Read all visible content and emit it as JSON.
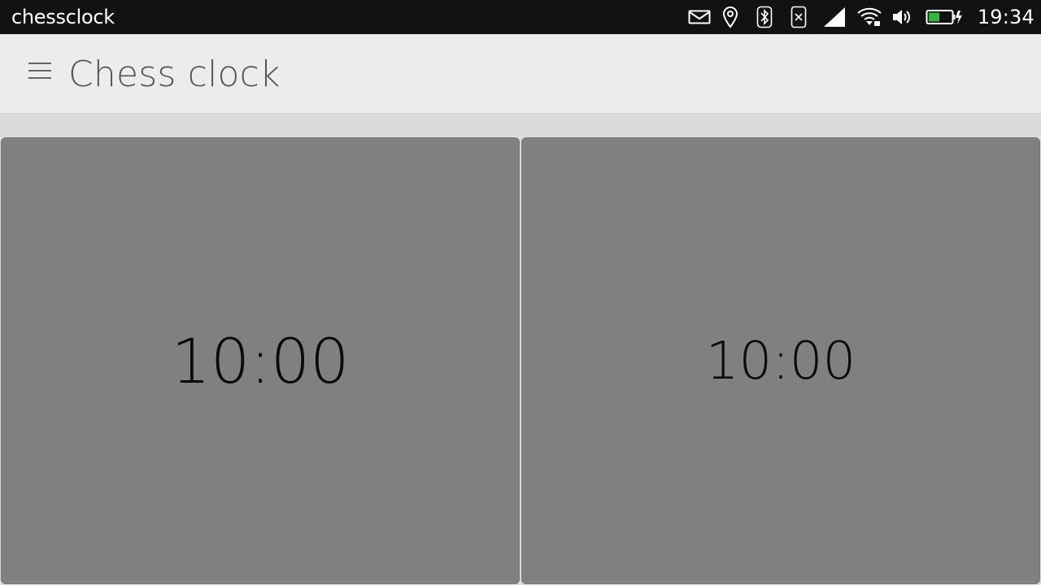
{
  "statusbar": {
    "app_name": "chessclock",
    "time": "19:34",
    "icons": [
      "mail-icon",
      "location-icon",
      "bluetooth-icon",
      "no-sim-icon",
      "signal-icon",
      "wifi-icon",
      "volume-icon",
      "battery-charging-icon"
    ],
    "battery_color": "#3cb043"
  },
  "header": {
    "title": "Chess clock",
    "menu_icon": "hamburger-menu-icon"
  },
  "clocks": {
    "left": {
      "time": "10:00"
    },
    "right": {
      "time": "10:00"
    }
  },
  "colors": {
    "panel": "#808080",
    "statusbar": "#121212",
    "header": "#ececec"
  }
}
